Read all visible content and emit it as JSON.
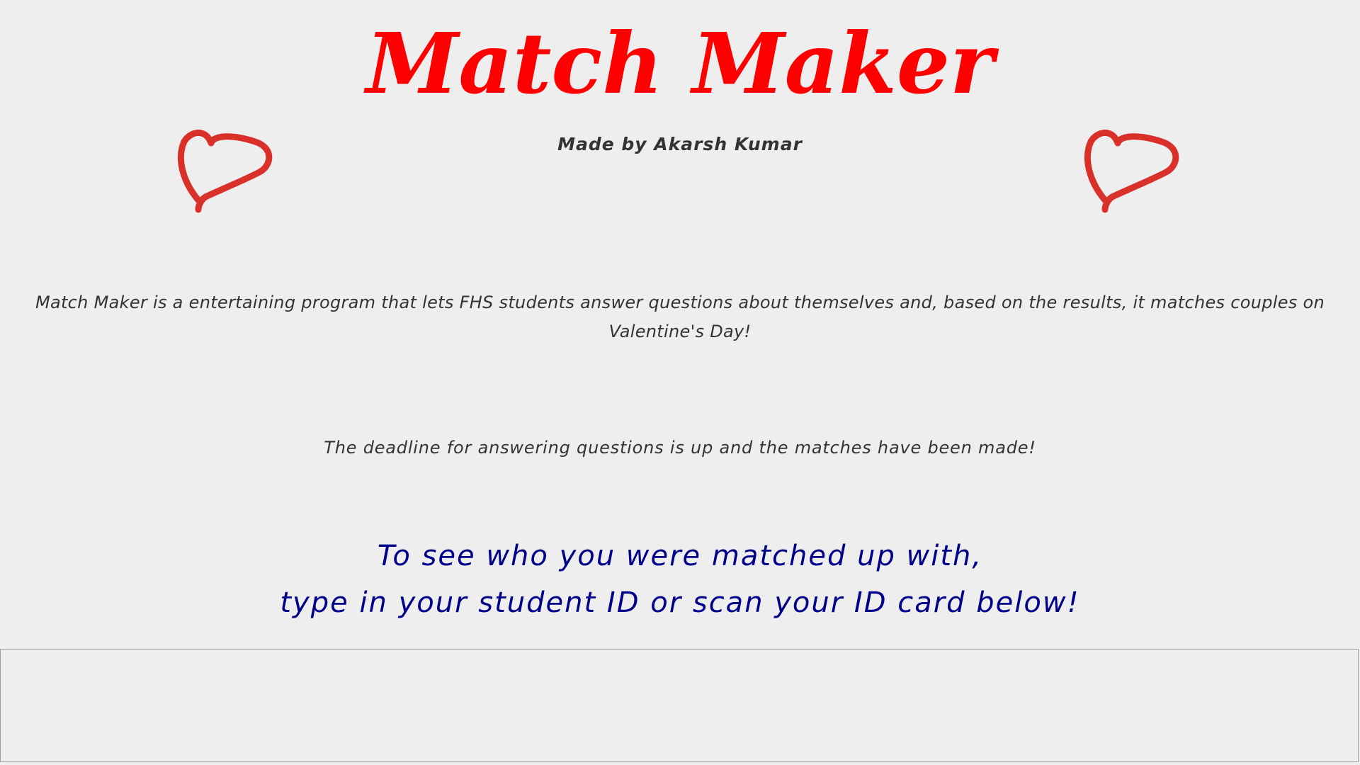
{
  "title": "Match Maker",
  "author": "Made by Akarsh Kumar",
  "description": "Match Maker is a entertaining program that lets FHS students answer questions about themselves and, based on the results, it matches couples on Valentine's Day!",
  "deadline": "The deadline for answering questions is up and the matches have been made!",
  "instructions": {
    "line1": "To see who you were matched up with,",
    "line2": "type in your student ID or scan your ID card below!"
  },
  "student_id_input": {
    "value": "",
    "placeholder": ""
  },
  "icons": {
    "left_heart": "heart-icon",
    "right_heart": "heart-icon"
  },
  "colors": {
    "title": "#ff0000",
    "heart": "#d9302a",
    "body_text": "#333333",
    "instructions": "#00008b",
    "background": "#eeeeee"
  }
}
